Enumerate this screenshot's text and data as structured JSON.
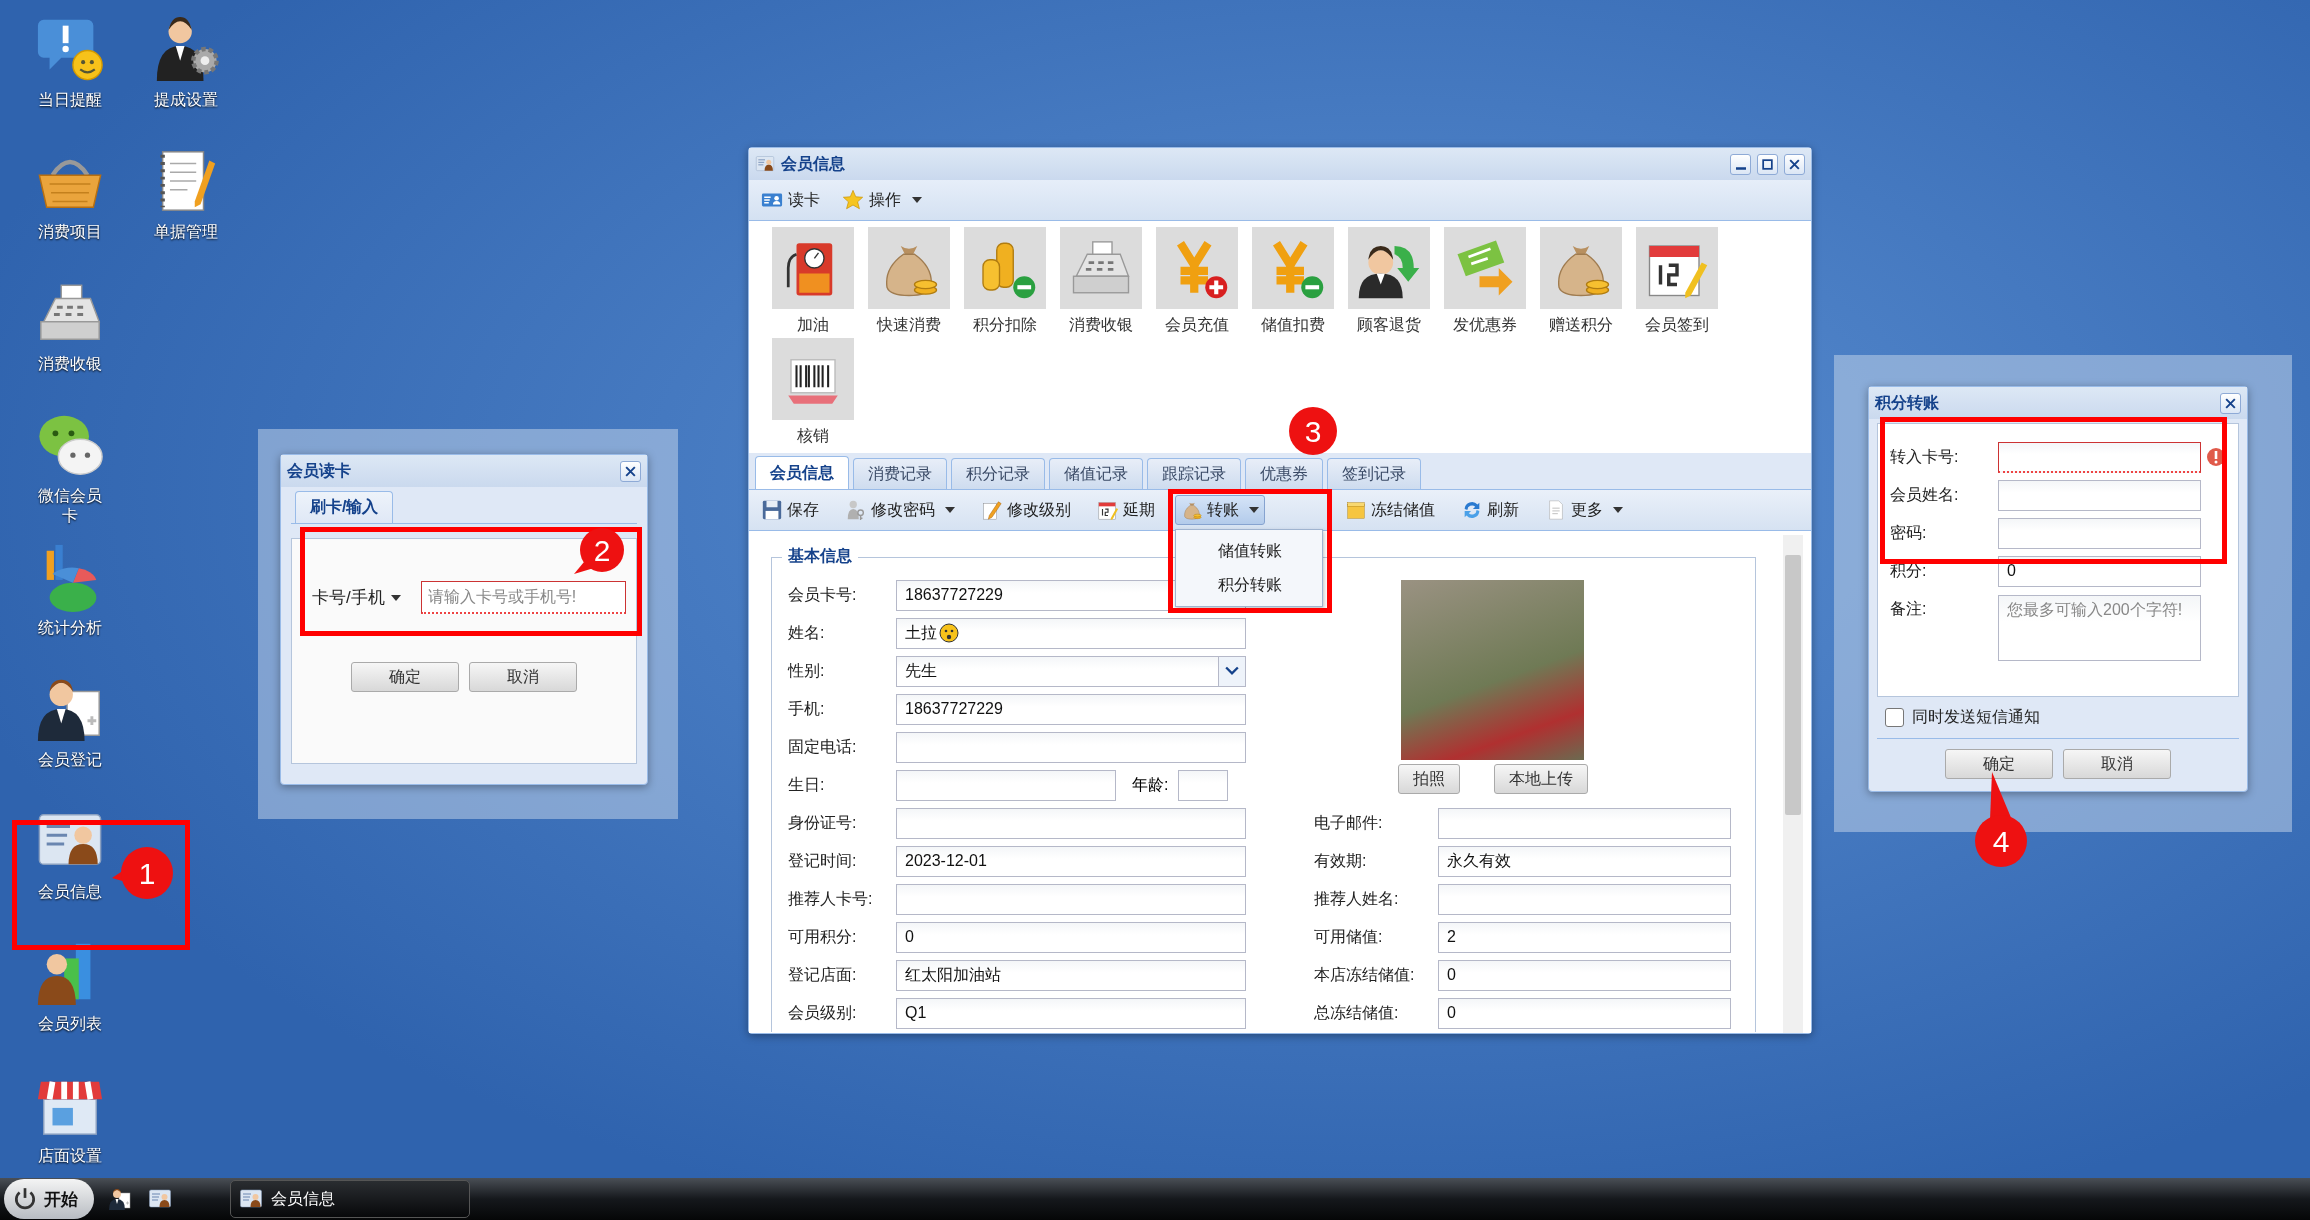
{
  "desktop_columns": [
    {
      "icons": [
        {
          "label": "当日提醒",
          "kind": "reminder"
        },
        {
          "label": "消费项目",
          "kind": "basket"
        },
        {
          "label": "消费收银",
          "kind": "register"
        },
        {
          "label": "微信会员卡",
          "kind": "wechat"
        },
        {
          "label": "统计分析",
          "kind": "chart"
        },
        {
          "label": "会员登记",
          "kind": "member_add"
        },
        {
          "label": "会员信息",
          "kind": "member_info"
        },
        {
          "label": "会员列表",
          "kind": "member_list"
        },
        {
          "label": "店面设置",
          "kind": "store"
        }
      ]
    },
    {
      "icons": [
        {
          "label": "提成设置",
          "kind": "commission"
        },
        {
          "label": "单据管理",
          "kind": "notepad"
        }
      ]
    }
  ],
  "card_dialog": {
    "title": "会员读卡",
    "tabs": [
      {
        "label": "刷卡/输入",
        "selected": true
      }
    ],
    "mode": "卡号/手机",
    "placeholder": "请输入卡号或手机号!",
    "invalid": true,
    "buttons": [
      "确定",
      "取消"
    ]
  },
  "member_window": {
    "title": "会员信息",
    "toolbar": [
      {
        "label": "读卡",
        "kind": "card",
        "dropdown": false
      },
      {
        "label": "操作",
        "kind": "star",
        "dropdown": true
      }
    ],
    "functions": [
      {
        "label": "加油",
        "kind": "fuel"
      },
      {
        "label": "快速消费",
        "kind": "bag"
      },
      {
        "label": "积分扣除",
        "kind": "coins_minus"
      },
      {
        "label": "消费收银",
        "kind": "register"
      },
      {
        "label": "会员充值",
        "kind": "yen_plus"
      },
      {
        "label": "储值扣费",
        "kind": "yen_minus"
      },
      {
        "label": "顾客退货",
        "kind": "return"
      },
      {
        "label": "发优惠券",
        "kind": "ticket"
      },
      {
        "label": "赠送积分",
        "kind": "bag"
      },
      {
        "label": "会员签到",
        "kind": "calendar"
      },
      {
        "label": "核销",
        "kind": "barcode"
      }
    ],
    "tabs": [
      {
        "label": "会员信息",
        "selected": true
      },
      {
        "label": "消费记录",
        "selected": false
      },
      {
        "label": "积分记录",
        "selected": false
      },
      {
        "label": "储值记录",
        "selected": false
      },
      {
        "label": "跟踪记录",
        "selected": false
      },
      {
        "label": "优惠券",
        "selected": false
      },
      {
        "label": "签到记录",
        "selected": false
      }
    ],
    "actions": [
      {
        "label": "保存",
        "kind": "save",
        "dropdown": false,
        "pressed": false
      },
      {
        "label": "修改密码",
        "kind": "key",
        "dropdown": true,
        "pressed": false
      },
      {
        "label": "修改级别",
        "kind": "edit",
        "dropdown": false,
        "pressed": false
      },
      {
        "label": "延期",
        "kind": "calendar",
        "dropdown": false,
        "pressed": false
      },
      {
        "label": "转账",
        "kind": "bag",
        "dropdown": true,
        "pressed": true
      },
      {
        "label": "冻结储值",
        "kind": "freeze",
        "dropdown": false,
        "pressed": false
      },
      {
        "label": "刷新",
        "kind": "refresh",
        "dropdown": false,
        "pressed": false
      },
      {
        "label": "更多",
        "kind": "doc",
        "dropdown": true,
        "pressed": false
      }
    ],
    "menu": [
      "储值转账",
      "积分转账"
    ],
    "section": "基本信息",
    "fields_left": [
      {
        "label": "会员卡号:",
        "kind": "text",
        "value": "18637727229"
      },
      {
        "label": "姓名:",
        "kind": "name",
        "value": "土拉"
      },
      {
        "label": "性别:",
        "kind": "select",
        "value": "先生"
      },
      {
        "label": "手机:",
        "kind": "text",
        "value": "18637727229"
      },
      {
        "label": "固定电话:",
        "kind": "text"
      },
      {
        "label": "生日:",
        "kind": "birthday",
        "extra_label": "年龄:"
      },
      {
        "label": "身份证号:",
        "kind": "text"
      },
      {
        "label": "登记时间:",
        "kind": "text",
        "value": "2023-12-01"
      },
      {
        "label": "推荐人卡号:",
        "kind": "text"
      },
      {
        "label": "可用积分:",
        "kind": "text",
        "value": "0"
      },
      {
        "label": "登记店面:",
        "kind": "text",
        "value": "红太阳加油站"
      },
      {
        "label": "会员级别:",
        "kind": "text",
        "value": "Q1"
      }
    ],
    "fields_right": [
      {
        "label": "电子邮件:"
      },
      {
        "label": "有效期:",
        "value": "永久有效"
      },
      {
        "label": "推荐人姓名:"
      },
      {
        "label": "可用储值:",
        "value": "2"
      },
      {
        "label": "本店冻结储值:",
        "value": "0"
      },
      {
        "label": "总冻结储值:",
        "value": "0"
      }
    ],
    "photo_buttons": [
      "拍照",
      "本地上传"
    ]
  },
  "transfer_dialog": {
    "title": "积分转账",
    "fields": [
      {
        "label": "转入卡号:",
        "kind": "text",
        "invalid": true
      },
      {
        "label": "会员姓名:",
        "kind": "text",
        "invalid": false
      },
      {
        "label": "密码:",
        "kind": "text",
        "invalid": false
      },
      {
        "label": "积分:",
        "kind": "text",
        "invalid": false,
        "value": "0"
      },
      {
        "label": "备注:",
        "kind": "textarea",
        "invalid": false,
        "placeholder": "您最多可输入200个字符!"
      }
    ],
    "sms": {
      "label": "同时发送短信通知",
      "checked": false
    },
    "buttons": [
      "确定",
      "取消"
    ]
  },
  "callouts": [
    "1",
    "2",
    "3",
    "4"
  ],
  "taskbar": {
    "start": "开始",
    "quick_launch": [
      {
        "kind": "member_add"
      },
      {
        "kind": "member_info"
      }
    ],
    "tasks": [
      {
        "label": "会员信息",
        "kind": "member_info"
      }
    ]
  }
}
